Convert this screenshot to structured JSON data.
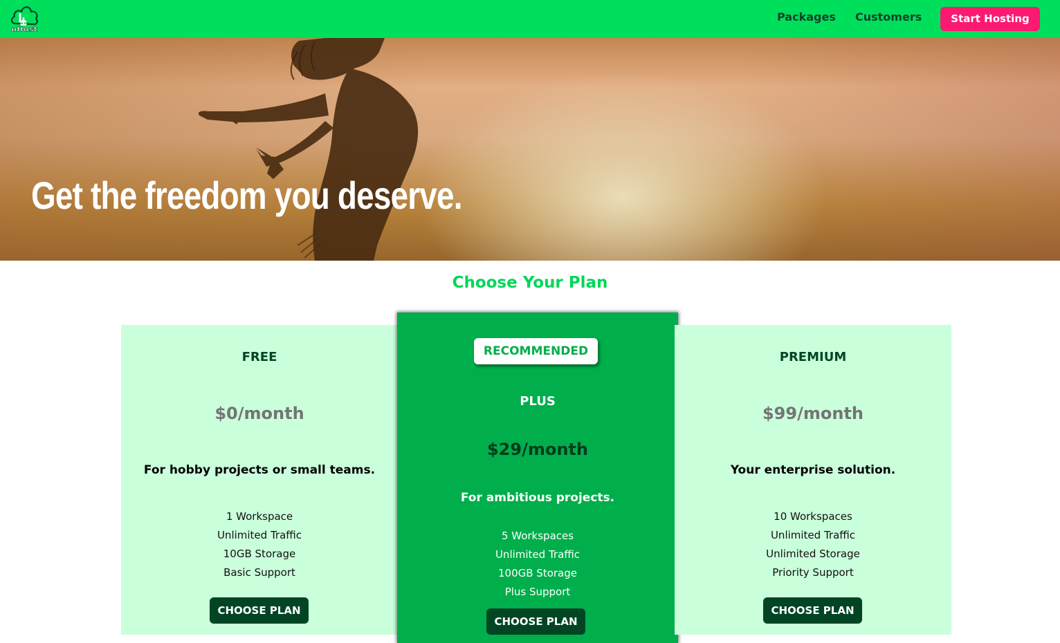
{
  "header": {
    "logo_text": "uHost",
    "nav": [
      "Packages",
      "Customers"
    ],
    "cta_label": "Start Hosting",
    "background_color": "#00df5b",
    "cta_color": "#fc1971"
  },
  "hero": {
    "title": "Get the freedom you deserve."
  },
  "plans_section": {
    "title": "Choose Your Plan",
    "plans": [
      {
        "name": "FREE",
        "price": "$0/month",
        "description": "For hobby projects or small teams.",
        "features": [
          "1 Workspace",
          "Unlimited Traffic",
          "10GB Storage",
          "Basic Support"
        ],
        "button_label": "CHOOSE PLAN"
      },
      {
        "badge": "RECOMMENDED",
        "name": "PLUS",
        "price": "$29/month",
        "description": "For ambitious projects.",
        "features": [
          "5 Workspaces",
          "Unlimited Traffic",
          "100GB Storage",
          "Plus Support"
        ],
        "button_label": "CHOOSE PLAN"
      },
      {
        "name": "PREMIUM",
        "price": "$99/month",
        "description": "Your enterprise solution.",
        "features": [
          "10 Workspaces",
          "Unlimited Traffic",
          "Unlimited Storage",
          "Priority Support"
        ],
        "button_label": "CHOOSE PLAN"
      }
    ]
  }
}
